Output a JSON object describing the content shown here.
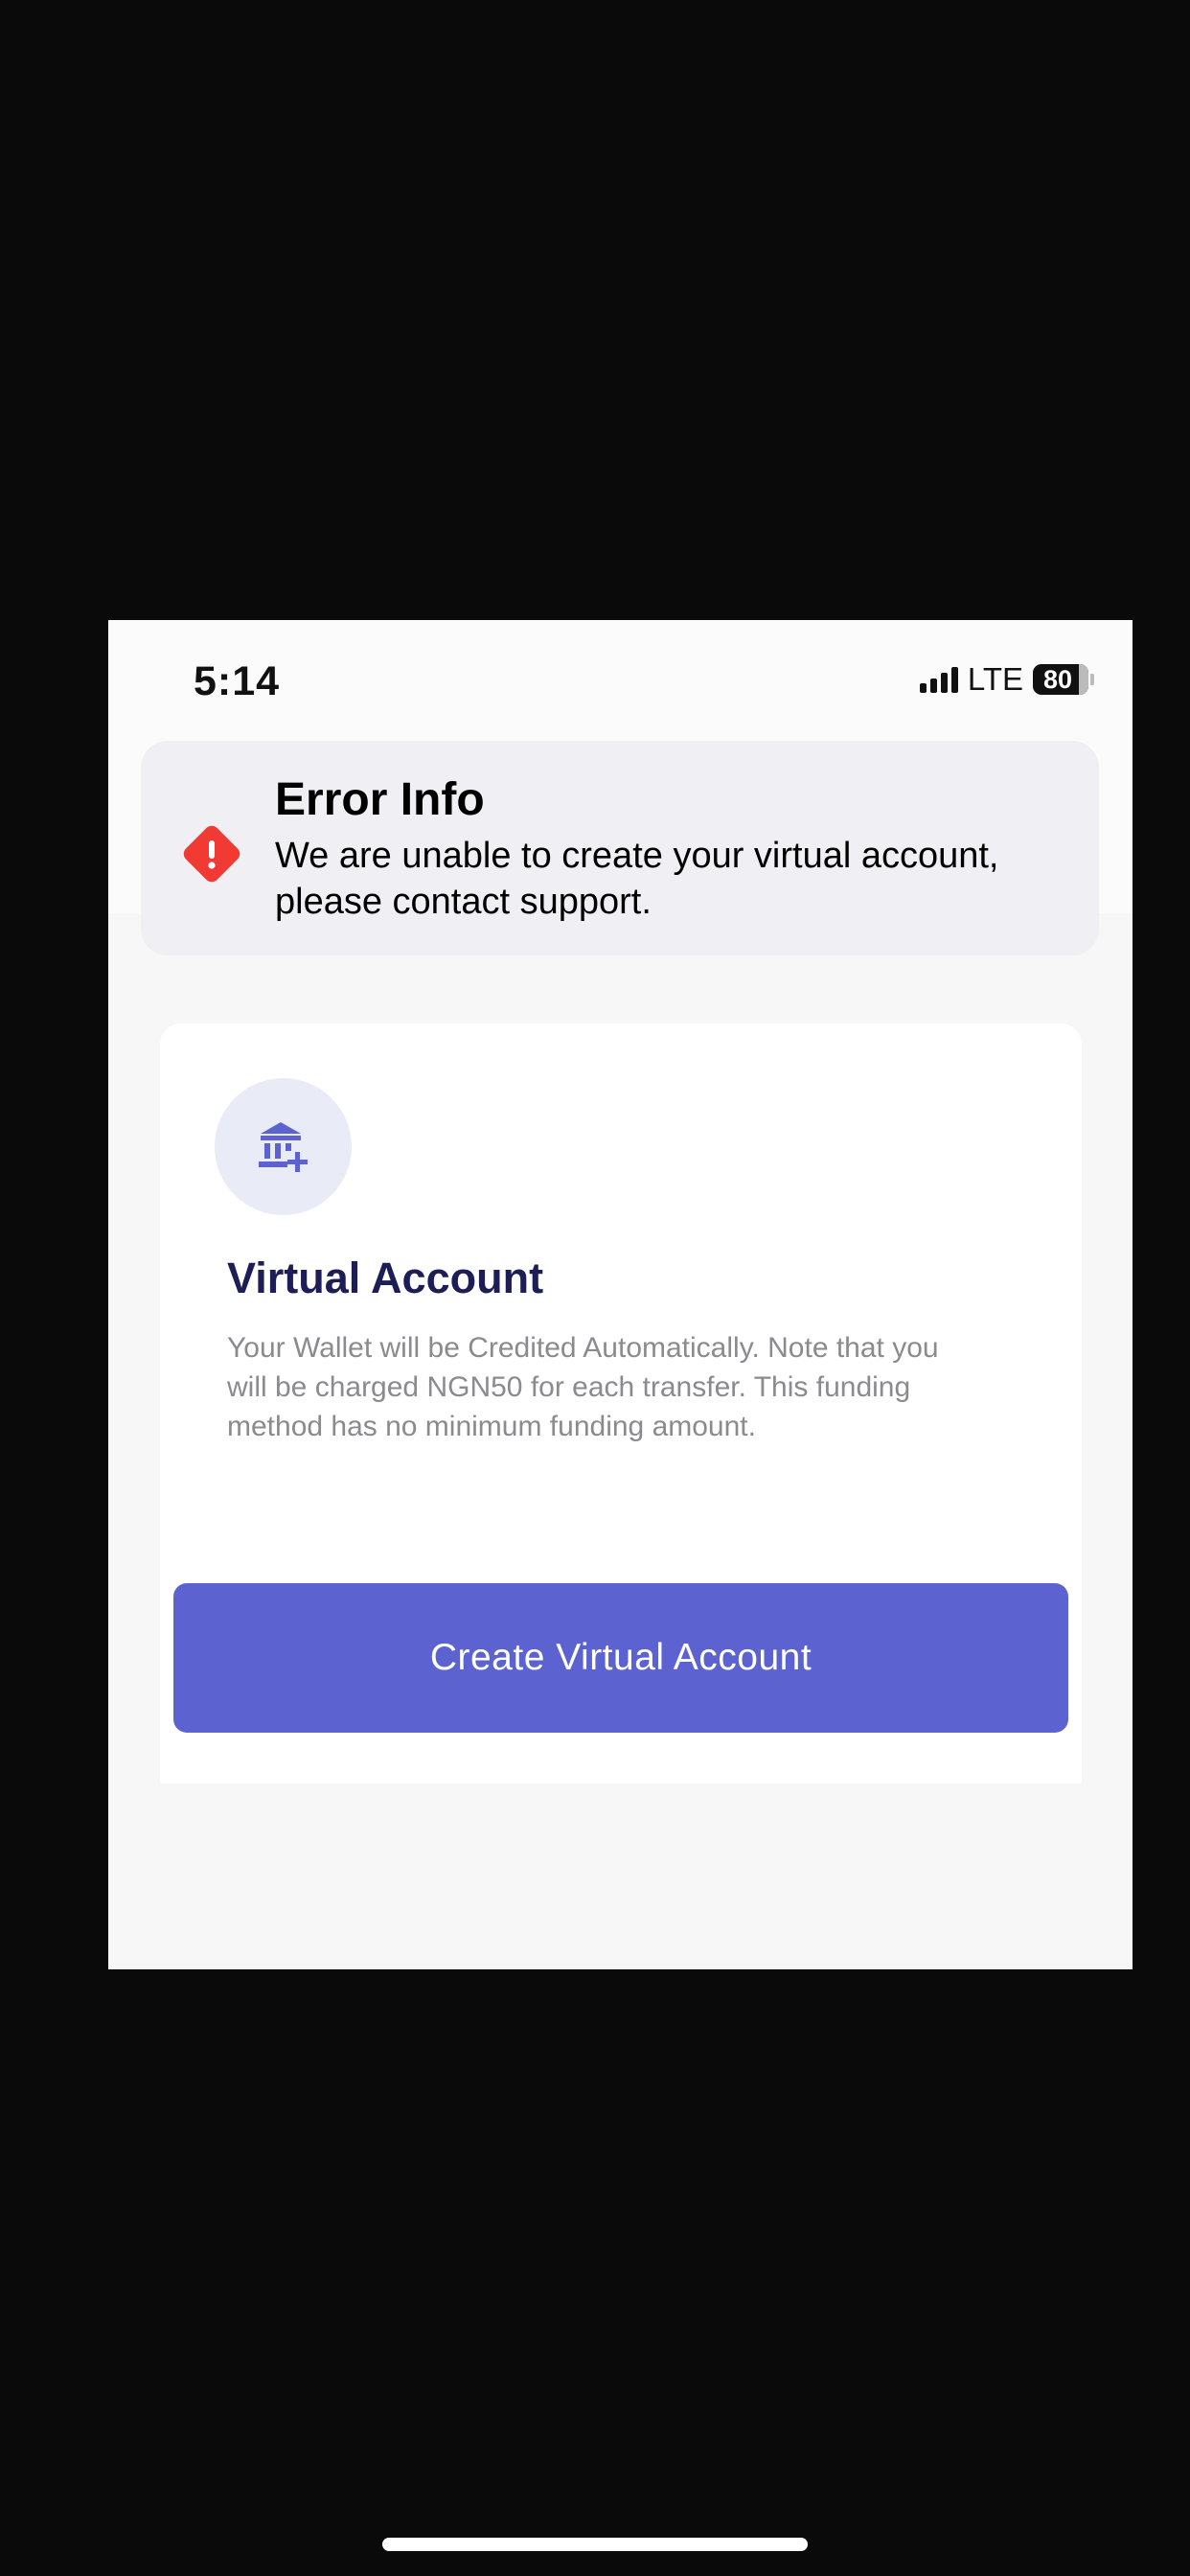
{
  "status_bar": {
    "time": "5:14",
    "network": "LTE",
    "battery": "80",
    "icons": [
      "signal-icon",
      "battery-icon"
    ]
  },
  "error_banner": {
    "icon": "warning-diamond-icon",
    "title": "Error Info",
    "message": "We are unable to create your virtual account, please contact support."
  },
  "card": {
    "icon": "bank-add-icon",
    "title": "Virtual Account",
    "description": "Your Wallet will be Credited Automatically. Note that you will be charged NGN50 for each transfer. This funding method has no minimum funding amount.",
    "button_label": "Create Virtual Account"
  },
  "colors": {
    "accent": "#5c63d1",
    "title": "#1d1d57",
    "error": "#f03a33",
    "icon_bg": "#e9ebf6"
  }
}
